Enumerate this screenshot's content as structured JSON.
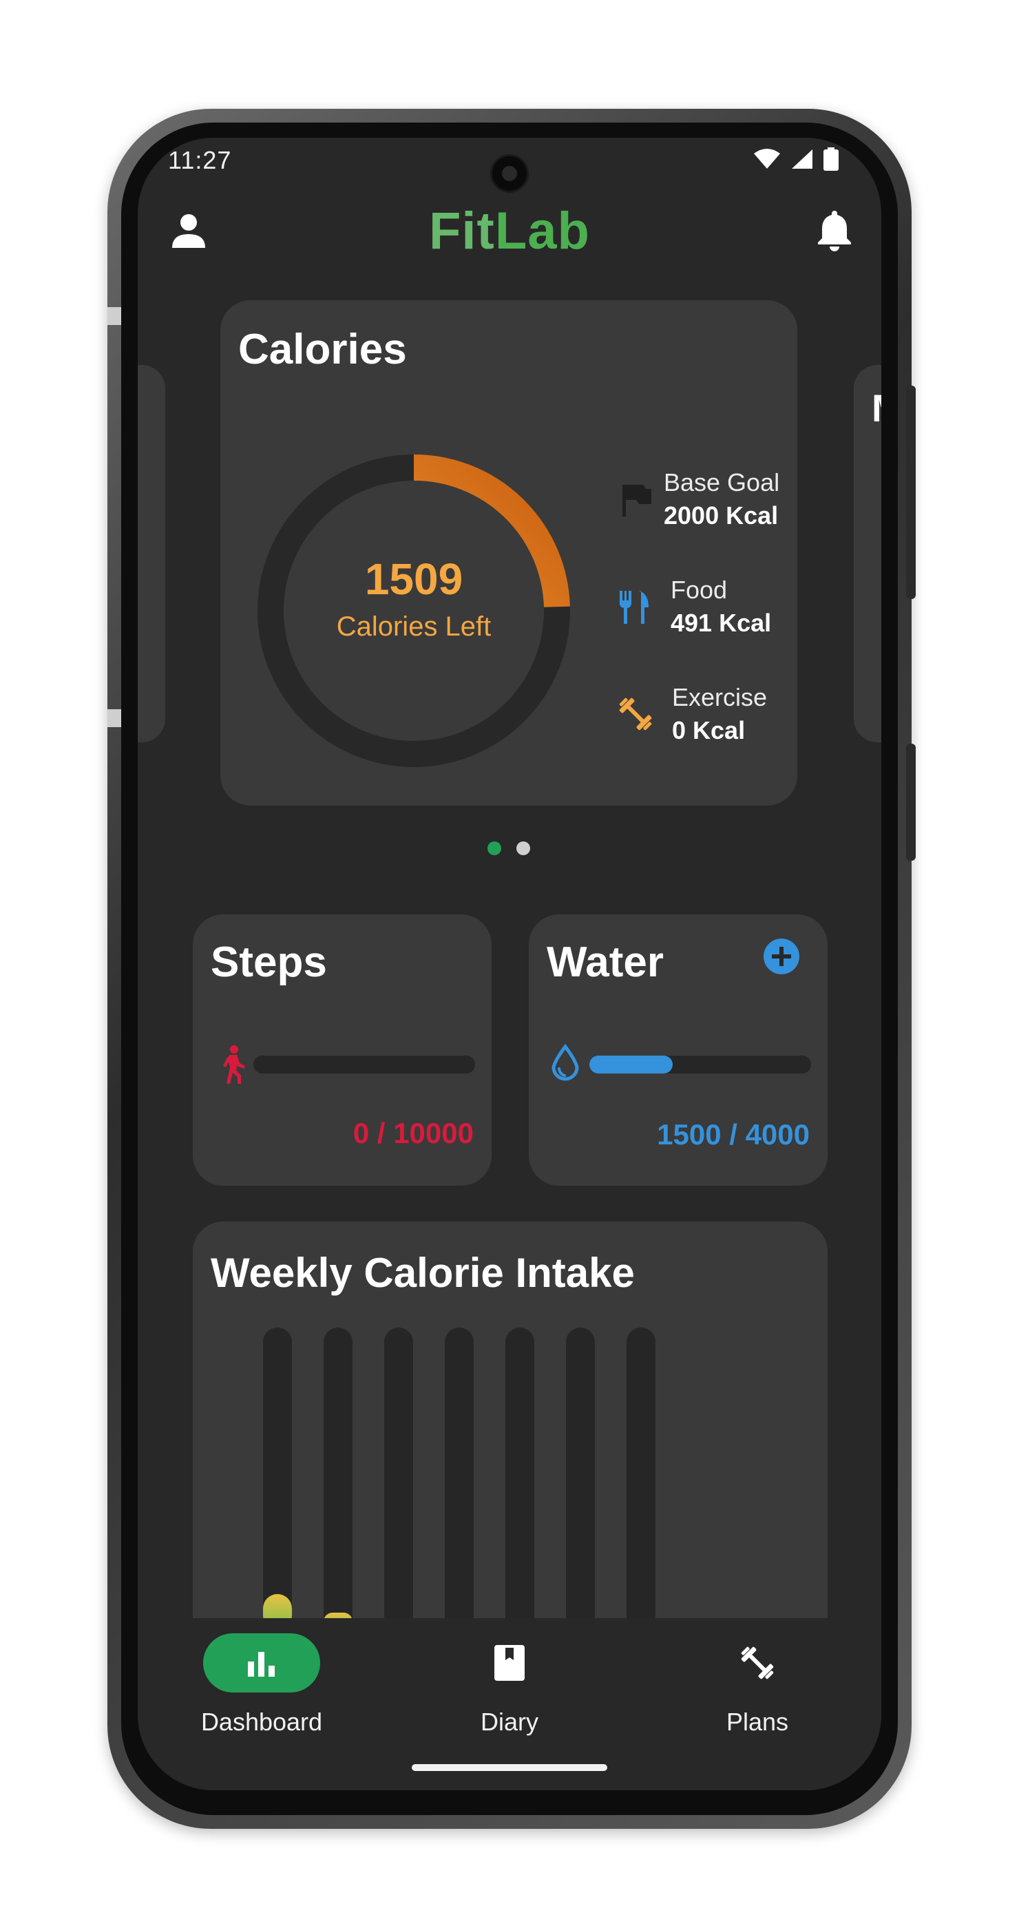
{
  "status_bar": {
    "time": "11:27"
  },
  "app": {
    "title_part1": "Fit",
    "title_part2": "Lab"
  },
  "next_card_peek": {
    "initial": "M"
  },
  "calories_card": {
    "title": "Calories",
    "remaining": "1509",
    "remaining_label": "Calories Left",
    "progress_fraction": 0.2455,
    "stats": [
      {
        "label": "Base Goal",
        "value": "2000 Kcal",
        "icon": "flag-icon"
      },
      {
        "label": "Food",
        "value": "491 Kcal",
        "icon": "utensils-icon"
      },
      {
        "label": "Exercise",
        "value": "0 Kcal",
        "icon": "dumbbell-icon"
      }
    ]
  },
  "pager": {
    "active_index": 0,
    "count": 2
  },
  "steps_card": {
    "title": "Steps",
    "count_text": "0 / 10000",
    "progress_fraction": 0.0,
    "icon": "walking-icon"
  },
  "water_card": {
    "title": "Water",
    "count_text": "1500 / 4000",
    "progress_fraction": 0.375,
    "icon": "water-drop-icon",
    "add_icon": "add-circle-icon"
  },
  "weekly_card": {
    "title": "Weekly Calorie Intake",
    "bar_fill_fractions": [
      0.12,
      0.06,
      0,
      0,
      0,
      0,
      0
    ]
  },
  "bottom_nav": {
    "items": [
      {
        "label": "Dashboard",
        "icon": "bar-chart-icon",
        "active": true
      },
      {
        "label": "Diary",
        "icon": "book-icon",
        "active": false
      },
      {
        "label": "Plans",
        "icon": "dumbbell-icon",
        "active": false
      }
    ]
  },
  "colors": {
    "background": "#282828",
    "card": "#3a3a3a",
    "brand_green": "#4caf50",
    "calorie_orange": "#f5a742",
    "steps_red": "#d81b3c",
    "water_blue": "#3592dc",
    "nav_active": "#22a058"
  }
}
